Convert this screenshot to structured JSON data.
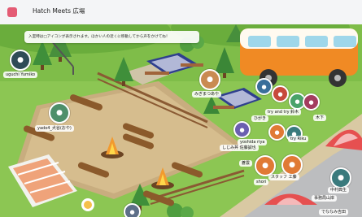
{
  "app": {
    "title": "Hatch Meets 広場"
  },
  "notice": {
    "text": "入室時は□アイコンが表示されます。ほかい人の近くに移動してから声をかけてね！"
  },
  "users": [
    {
      "id": "u1",
      "name": "uguchi Yumiko",
      "icon": "person-avatar",
      "color": "#2f4b56"
    },
    {
      "id": "u2",
      "name": "yado4_犬谷(おや)",
      "icon": "person-avatar",
      "color": "#4e8f6a"
    },
    {
      "id": "u3",
      "name": "みぎまつあや",
      "icon": "bear-avatar",
      "color": "#c98a52"
    },
    {
      "id": "u4",
      "name": "しじみ丼 佐藤誠也",
      "icon": "person-avatar",
      "color": "#c9a043"
    },
    {
      "id": "u5",
      "name": "yoshida riya",
      "icon": "person-avatar",
      "color": "#6b5fb0"
    },
    {
      "id": "u6",
      "name": "ひがき",
      "icon": "cat-avatar",
      "color": "#3a6e9a"
    },
    {
      "id": "u7",
      "name": "try and try 鈴木",
      "icon": "person-avatar",
      "color": "#c74a3c"
    },
    {
      "id": "u8",
      "name": "木下",
      "icon": "person-avatar",
      "color": "#4aa36a"
    },
    {
      "id": "u9",
      "name": "スタッフ 工藤",
      "icon": "fox-avatar",
      "color": "#e07a35"
    },
    {
      "id": "u10",
      "name": "try Riku",
      "icon": "person-avatar",
      "color": "#a33d5f"
    },
    {
      "id": "u11",
      "name": "shori",
      "icon": "fox-avatar",
      "color": "#e07a35"
    },
    {
      "id": "u12",
      "name": "蒼雲",
      "icon": "person-avatar",
      "color": "#5d6f88"
    },
    {
      "id": "u13",
      "name": "中村典生",
      "icon": "person-avatar",
      "color": "#397a7d"
    },
    {
      "id": "u14",
      "name": "事務局山岸",
      "icon": "person-avatar",
      "color": "#b5553a"
    },
    {
      "id": "u15",
      "name": "でななみ吉田",
      "icon": "person-avatar",
      "color": "#7b8c3a"
    }
  ]
}
